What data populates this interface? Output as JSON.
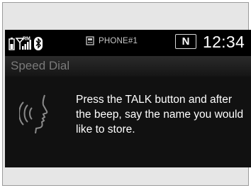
{
  "status": {
    "phone_label": "PHONE#1",
    "mode": "N",
    "clock": "12:34",
    "roaming": "RM",
    "icons": [
      "phone-battery-icon",
      "signal-strength-icon",
      "bluetooth-icon",
      "phone-icon"
    ]
  },
  "header": {
    "title": "Speed Dial"
  },
  "main": {
    "message": "Press the TALK button and after the beep, say the name you would like to store.",
    "icon": "voice-command-icon"
  },
  "colors": {
    "screen_bg": "#000000",
    "text": "#ffffff",
    "title_text": "#7a7a7a"
  }
}
